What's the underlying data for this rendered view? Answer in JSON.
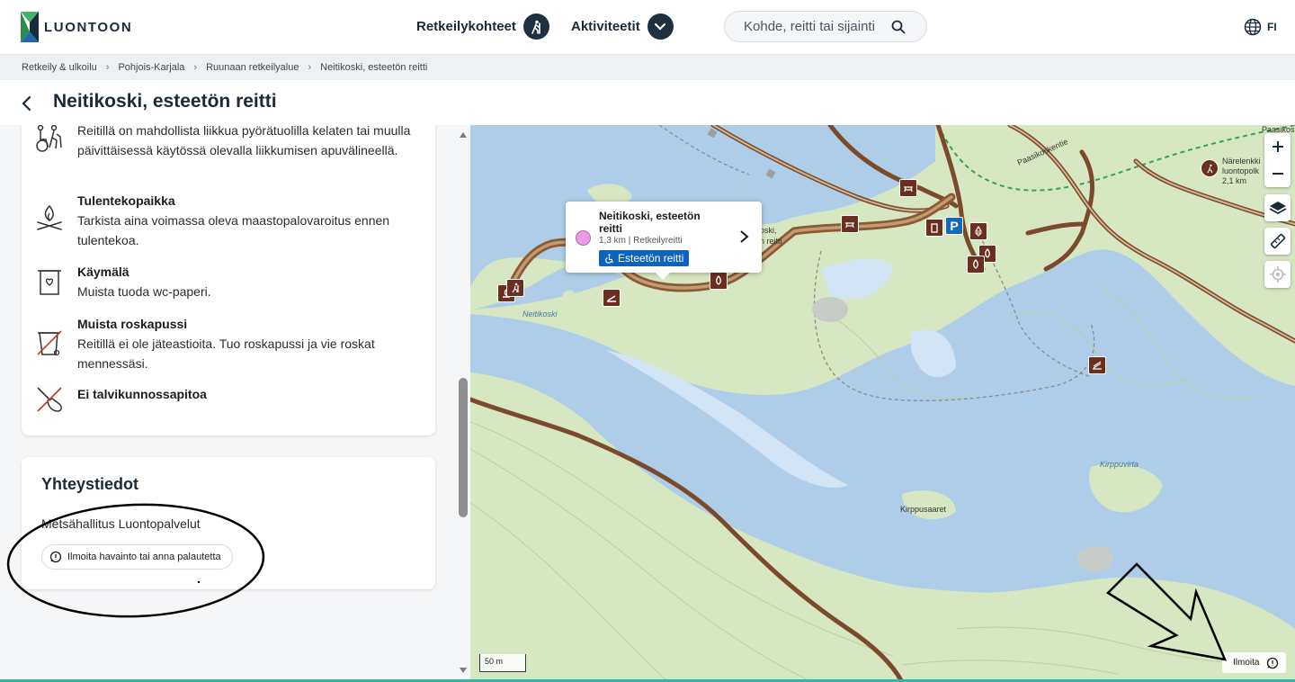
{
  "header": {
    "logo_text": "LUONTOON",
    "nav": [
      {
        "label": "Retkeilykohteet",
        "icon": "hiker-icon"
      },
      {
        "label": "Aktiviteetit",
        "icon": "chevron-down-icon"
      }
    ],
    "search_placeholder": "Kohde, reitti tai sijainti",
    "language": "FI"
  },
  "breadcrumb": [
    "Retkeily & ulkoilu",
    "Pohjois-Karjala",
    "Ruunaan retkeilyalue",
    "Neitikoski, esteetön reitti"
  ],
  "page_title": "Neitikoski, esteetön reitti",
  "features": [
    {
      "icon": "wheelchair-icon",
      "title": "",
      "desc": "Reitillä on mahdollista liikkua pyörätuolilla kelaten tai muulla päivittäisessä käytössä olevalla liikkumisen apuvälineellä."
    },
    {
      "icon": "campfire-icon",
      "title": "Tulentekopaikka",
      "desc": "Tarkista aina voimassa oleva maastopalovaroitus ennen tulentekoa."
    },
    {
      "icon": "toilet-icon",
      "title": "Käymälä",
      "desc": "Muista tuoda wc-paperi."
    },
    {
      "icon": "no-trash-icon",
      "title": "Muista roskapussi",
      "desc": "Reitillä ei ole jäteastioita. Tuo roskapussi ja vie roskat mennessäsi."
    },
    {
      "icon": "no-winter-maintenance-icon",
      "title": "Ei talvikunnossapitoa",
      "desc": ""
    }
  ],
  "contact": {
    "heading": "Yhteystiedot",
    "org": "Metsähallitus Luontopalvelut",
    "feedback_label": "Ilmoita havainto tai anna palautetta"
  },
  "map": {
    "popup": {
      "title": "Neitikoski, esteetön reitti",
      "meta": "1,3 km | Retkeilyreitti",
      "badge": "Esteetön reitti"
    },
    "labels": {
      "neitikoski": "Neitikoski",
      "kirppuvirta": "Kirppuvirta",
      "kirppusaaret": "Kirppusaaret",
      "paasikoski": "Paasikoski",
      "paasikoskentie": "Paasikoskentie",
      "narelenkki": "Närelenkki",
      "luontopolku": "luontopolk",
      "distance": "2,1 km",
      "behind_popup_1": "oski,",
      "behind_popup_2": "n reitti"
    },
    "scale": "50 m",
    "report_label": "Ilmoita"
  },
  "colors": {
    "trail": "#9b6b43",
    "water": "#aecde8",
    "land": "#d7e7c2",
    "accent": "#0d63b8",
    "poi": "#6b2f1f"
  }
}
